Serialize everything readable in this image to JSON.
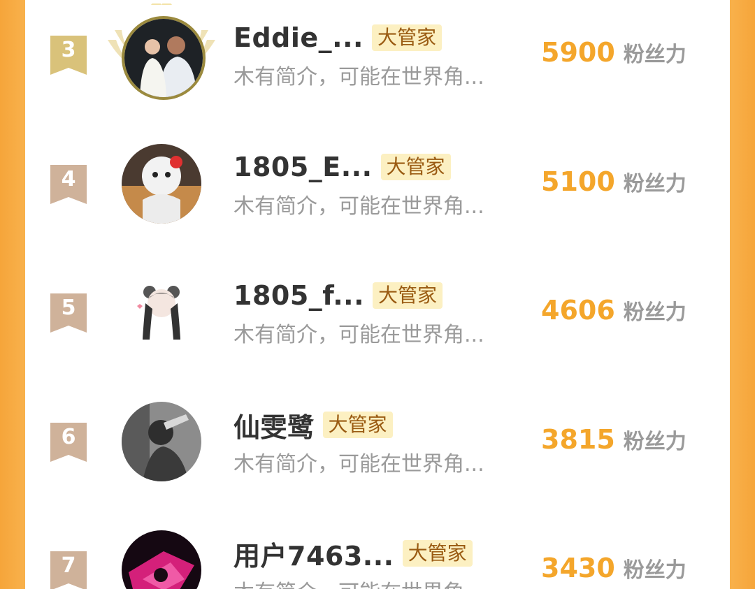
{
  "list": {
    "items": [
      {
        "rank": "3",
        "name": "Eddie_...",
        "tag": "大管家",
        "bio": "木有简介，可能在世界角...",
        "score": "5900",
        "unit": "粉丝力"
      },
      {
        "rank": "4",
        "name": "1805_E...",
        "tag": "大管家",
        "bio": "木有简介，可能在世界角...",
        "score": "5100",
        "unit": "粉丝力"
      },
      {
        "rank": "5",
        "name": "1805_f...",
        "tag": "大管家",
        "bio": "木有简介，可能在世界角...",
        "score": "4606",
        "unit": "粉丝力"
      },
      {
        "rank": "6",
        "name": "仙雯鹭",
        "tag": "大管家",
        "bio": "木有简介，可能在世界角...",
        "score": "3815",
        "unit": "粉丝力"
      },
      {
        "rank": "7",
        "name": "用户7463...",
        "tag": "大管家",
        "bio": "木有简介，可能在世界角...",
        "score": "3430",
        "unit": "粉丝力"
      }
    ]
  },
  "colors": {
    "accent": "#f4a62b",
    "badge_gold": "#d9c27a",
    "badge_bronze": "#cfb29a",
    "tag_bg": "#fcf0c2",
    "frame_orange": "#f8b04a"
  }
}
